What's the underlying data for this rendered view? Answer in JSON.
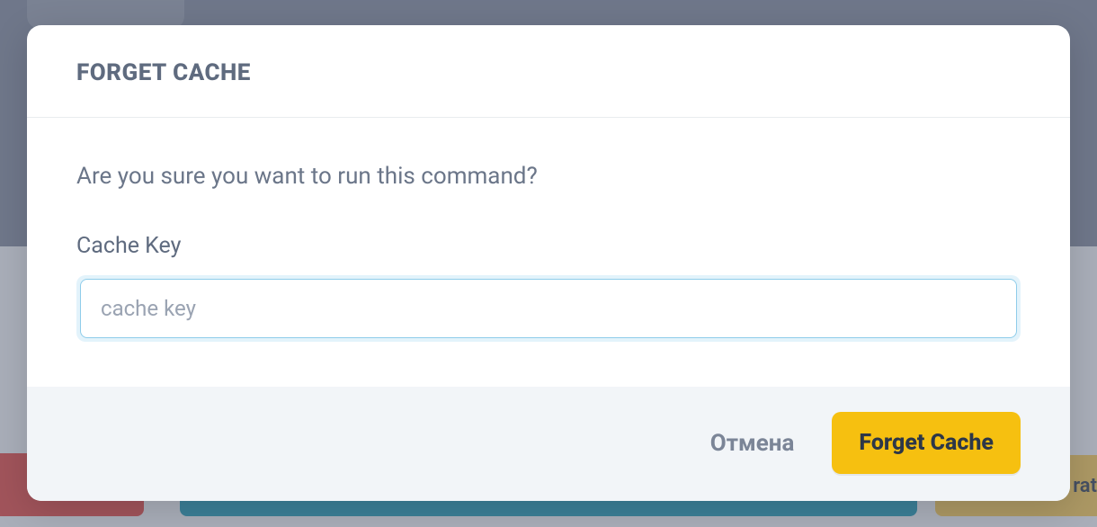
{
  "modal": {
    "title": "FORGET CACHE",
    "question": "Are you sure you want to run this command?",
    "field": {
      "label": "Cache Key",
      "placeholder": "cache key",
      "value": ""
    },
    "buttons": {
      "cancel": "Отмена",
      "confirm": "Forget Cache"
    }
  },
  "background": {
    "partial_button_text": "rat"
  }
}
